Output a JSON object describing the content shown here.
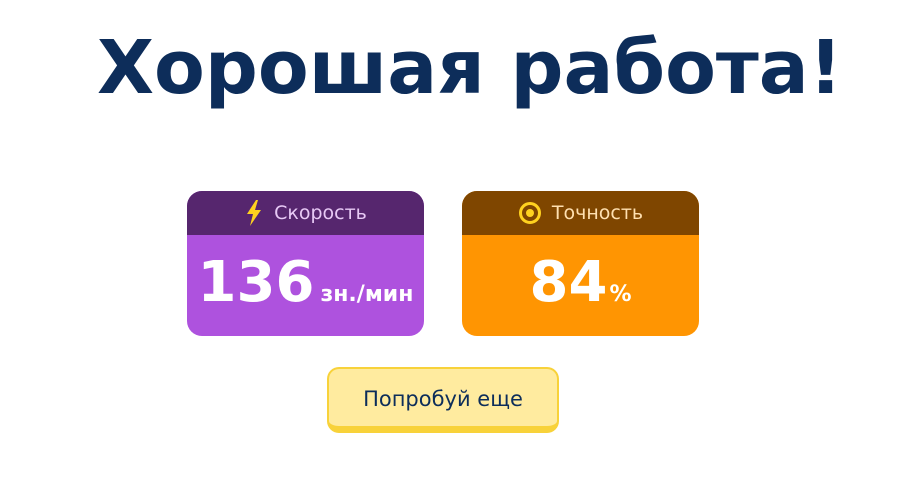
{
  "title": "Хорошая работа!",
  "cards": {
    "speed": {
      "label": "Скорость",
      "icon": "lightning-icon",
      "value": "136",
      "unit": "зн./мин",
      "header_color": "#56266e",
      "body_color": "#ae52de"
    },
    "accuracy": {
      "label": "Точность",
      "icon": "target-icon",
      "value": "84",
      "unit": "%",
      "header_color": "#7f4600",
      "body_color": "#ff9502"
    }
  },
  "button": {
    "label": "Попробуй еще",
    "background": "#ffeb9f",
    "border": "#f8d23a"
  },
  "colors": {
    "title": "#0d2d5a"
  }
}
